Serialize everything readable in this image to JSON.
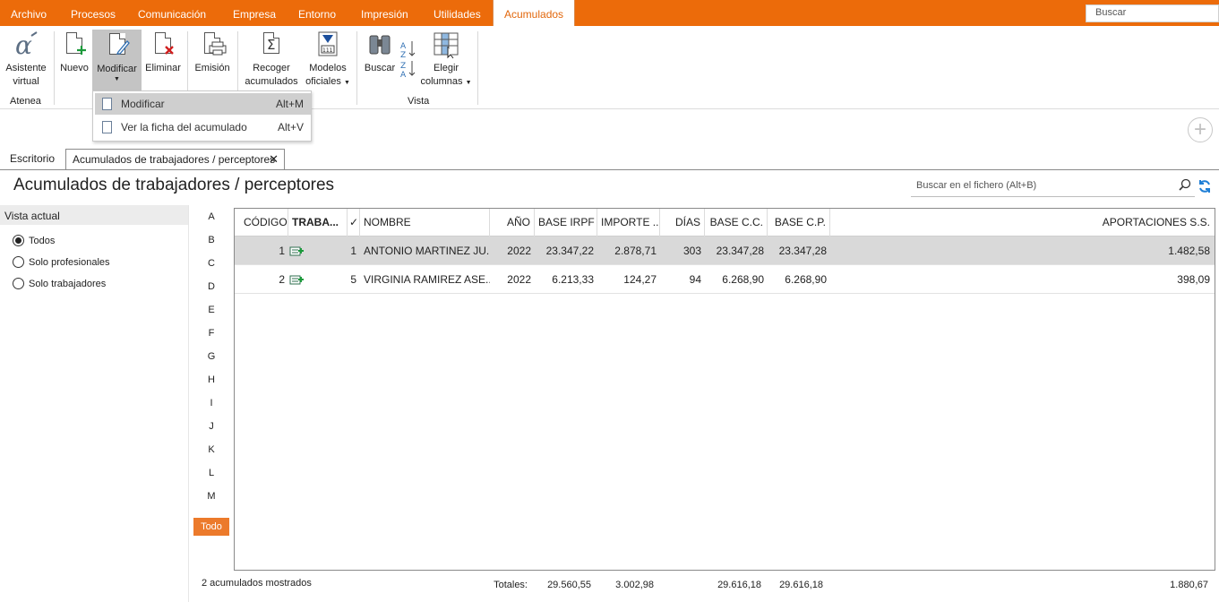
{
  "menu": {
    "tabs": [
      "Archivo",
      "Procesos",
      "Comunicación",
      "Empresa",
      "Entorno",
      "Impresión",
      "Utilidades",
      "Acumulados"
    ],
    "search_placeholder": "Buscar"
  },
  "ribbon": {
    "asistente": [
      "Asistente",
      "virtual"
    ],
    "atenea_group": "Atenea",
    "nuevo": "Nuevo",
    "modificar": "Modificar",
    "eliminar": "Eliminar",
    "emision": "Emisión",
    "recoger": [
      "Recoger",
      "acumulados"
    ],
    "modelos": [
      "Modelos",
      "oficiales"
    ],
    "buscar": "Buscar",
    "elegir": [
      "Elegir",
      "columnas"
    ],
    "vista_group": "Vista"
  },
  "dropdown": {
    "items": [
      {
        "label": "Modificar",
        "shortcut": "Alt+M"
      },
      {
        "label": "Ver la ficha del acumulado",
        "shortcut": "Alt+V"
      }
    ]
  },
  "tabs": {
    "escritorio": "Escritorio",
    "active": "Acumulados de trabajadores / perceptores"
  },
  "page": {
    "title": "Acumulados de trabajadores / perceptores",
    "file_search_placeholder": "Buscar en el fichero (Alt+B)"
  },
  "vista": {
    "header": "Vista actual",
    "options": [
      "Todos",
      "Solo profesionales",
      "Solo trabajadores"
    ],
    "selected": "Todos"
  },
  "letters": [
    "A",
    "B",
    "C",
    "D",
    "E",
    "F",
    "G",
    "H",
    "I",
    "J",
    "K",
    "L",
    "M"
  ],
  "todo_label": "Todo",
  "table": {
    "columns": [
      "CÓDIGO",
      "TRABA...",
      "✓",
      "NOMBRE",
      "AÑO",
      "BASE IRPF",
      "IMPORTE ...",
      "DÍAS",
      "BASE C.C.",
      "BASE C.P.",
      "APORTACIONES S.S."
    ],
    "rows": [
      {
        "codigo": "1",
        "trab": "1",
        "nombre": "ANTONIO MARTINEZ JU...",
        "anio": "2022",
        "base_irpf": "23.347,22",
        "importe": "2.878,71",
        "dias": "303",
        "base_cc": "23.347,28",
        "base_cp": "23.347,28",
        "aportaciones": "1.482,58"
      },
      {
        "codigo": "2",
        "trab": "5",
        "nombre": "VIRGINIA RAMIREZ ASE...",
        "anio": "2022",
        "base_irpf": "6.213,33",
        "importe": "124,27",
        "dias": "94",
        "base_cc": "6.268,90",
        "base_cp": "6.268,90",
        "aportaciones": "398,09"
      }
    ]
  },
  "footer": {
    "count": "2 acumulados mostrados",
    "totales_label": "Totales:",
    "base_irpf": "29.560,55",
    "importe": "3.002,98",
    "base_cc": "29.616,18",
    "base_cp": "29.616,18",
    "aportaciones": "1.880,67"
  },
  "colors": {
    "accent": "#ec6b0a",
    "todo": "#ec7a2b",
    "selected_row": "#d9d9d9"
  }
}
